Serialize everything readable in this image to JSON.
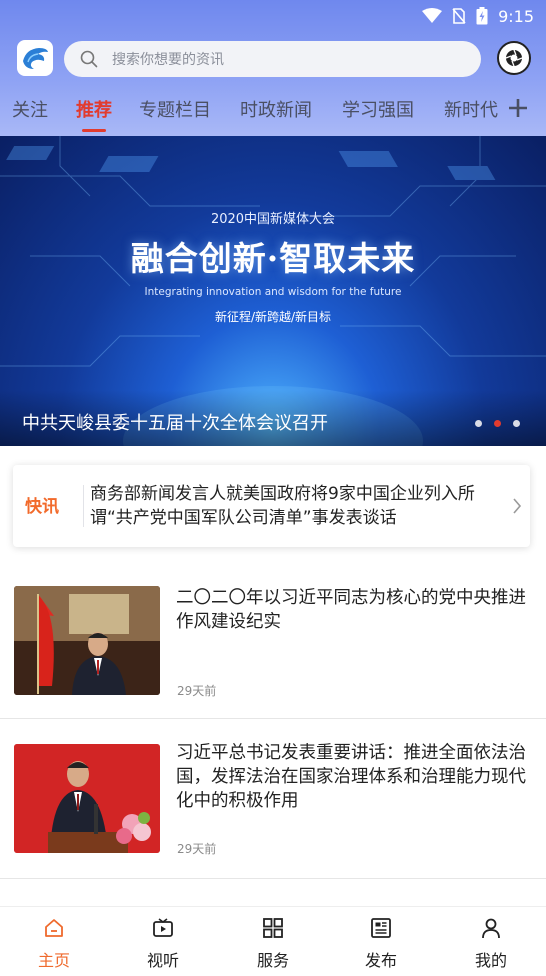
{
  "status_bar": {
    "time": "9:15"
  },
  "search": {
    "placeholder": "搜索你想要的资讯"
  },
  "tabs": [
    {
      "label": "关注",
      "active": false
    },
    {
      "label": "推荐",
      "active": true
    },
    {
      "label": "专题栏目",
      "active": false
    },
    {
      "label": "时政新闻",
      "active": false
    },
    {
      "label": "学习强国",
      "active": false
    },
    {
      "label": "新时代",
      "active": false
    }
  ],
  "banner": {
    "subtitle": "2020中国新媒体大会",
    "title": "融合创新·智取未来",
    "english": "Integrating innovation and wisdom for the future",
    "tagline": "新征程/新跨越/新目标",
    "caption": "中共天峻县委十五届十次全体会议召开",
    "slide_count": 3,
    "active_slide": 2
  },
  "flash_news": {
    "label": "快讯",
    "text": "商务部新闻发言人就美国政府将9家中国企业列入所谓“共产党中国军队公司清单”事发表谈话"
  },
  "news": [
    {
      "title": "二〇二〇年以习近平同志为核心的党中央推进作风建设纪实",
      "time": "29天前"
    },
    {
      "title": "习近平总书记发表重要讲话：推进全面依法治国，发挥法治在国家治理体系和治理能力现代化中的积极作用",
      "time": "29天前"
    }
  ],
  "bottom_nav": [
    {
      "label": "主页",
      "icon": "home-icon",
      "active": true
    },
    {
      "label": "视听",
      "icon": "video-icon",
      "active": false
    },
    {
      "label": "服务",
      "icon": "grid-icon",
      "active": false
    },
    {
      "label": "发布",
      "icon": "newspaper-icon",
      "active": false
    },
    {
      "label": "我的",
      "icon": "user-icon",
      "active": false
    }
  ],
  "colors": {
    "accent": "#e23b2e",
    "header": "#6f88ee",
    "flash": "#f26a2b",
    "nav_active": "#ef6a2d"
  }
}
